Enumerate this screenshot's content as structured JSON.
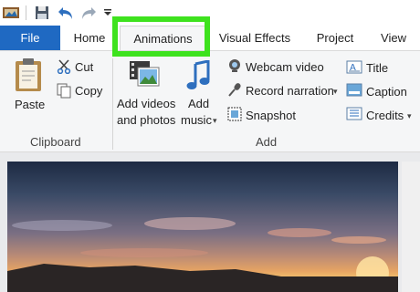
{
  "quick_access": {
    "icons": [
      "app-icon",
      "save-icon",
      "undo-icon",
      "redo-icon",
      "customize-icon"
    ]
  },
  "tabs": [
    {
      "label": "File"
    },
    {
      "label": "Home"
    },
    {
      "label": "Animations"
    },
    {
      "label": "Visual Effects"
    },
    {
      "label": "Project"
    },
    {
      "label": "View"
    }
  ],
  "ribbon": {
    "clipboard": {
      "paste_label": "Paste",
      "cut_label": "Cut",
      "copy_label": "Copy",
      "group_label": "Clipboard"
    },
    "add": {
      "add_videos_line1": "Add videos",
      "add_videos_line2": "and photos",
      "add_music_line1": "Add",
      "add_music_line2": "music",
      "webcam_label": "Webcam video",
      "narration_label": "Record narration",
      "snapshot_label": "Snapshot",
      "title_label": "Title",
      "caption_label": "Caption",
      "credits_label": "Credits",
      "group_label": "Add"
    }
  },
  "colors": {
    "file_tab": "#1f69c2",
    "highlight": "#3ee21e"
  }
}
